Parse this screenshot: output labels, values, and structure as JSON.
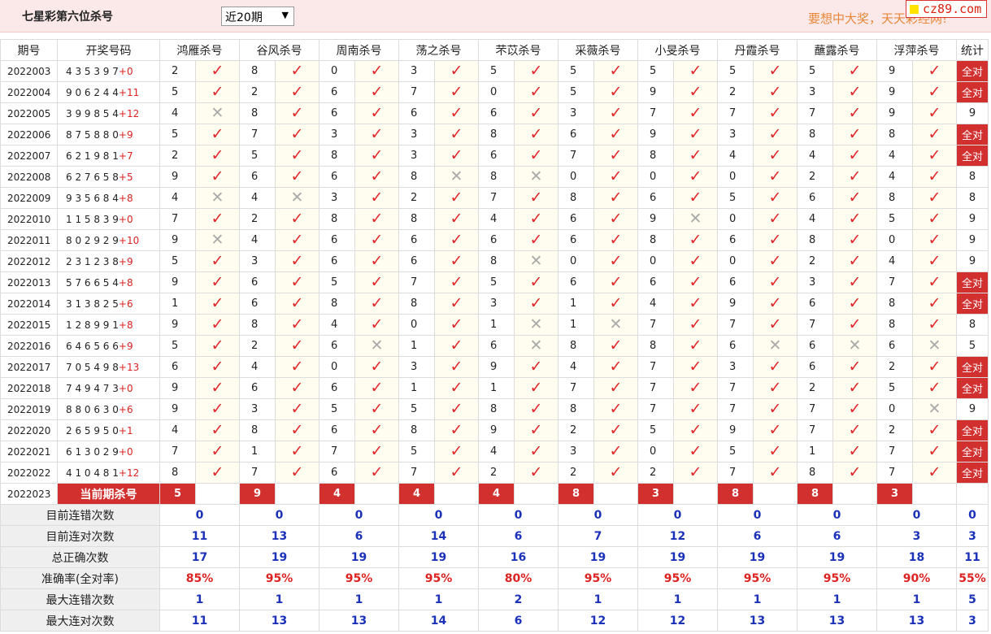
{
  "header": {
    "title": "七星彩第六位杀号",
    "period_select": "近20期",
    "slogan": "要想中大奖，天天彩经网!",
    "logo": "cz89.com"
  },
  "columns": {
    "issue": "期号",
    "draw": "开奖号码",
    "experts": [
      "鸿雁杀号",
      "谷风杀号",
      "周南杀号",
      "荡之杀号",
      "芣苡杀号",
      "采薇杀号",
      "小旻杀号",
      "丹霞杀号",
      "蘸露杀号",
      "浮萍杀号"
    ],
    "stat": "统计"
  },
  "rows": [
    {
      "issue": "2022003",
      "draw": "4 3 5 3 9 7",
      "plus": "+0",
      "kills": [
        2,
        8,
        0,
        3,
        5,
        5,
        5,
        5,
        5,
        9
      ],
      "ok": [
        1,
        1,
        1,
        1,
        1,
        1,
        1,
        1,
        1,
        1
      ],
      "stat": "全对"
    },
    {
      "issue": "2022004",
      "draw": "9 0 6 2 4 4",
      "plus": "+11",
      "kills": [
        5,
        2,
        6,
        7,
        0,
        5,
        9,
        2,
        3,
        9
      ],
      "ok": [
        1,
        1,
        1,
        1,
        1,
        1,
        1,
        1,
        1,
        1
      ],
      "stat": "全对"
    },
    {
      "issue": "2022005",
      "draw": "3 9 9 8 5 4",
      "plus": "+12",
      "kills": [
        4,
        8,
        6,
        6,
        6,
        3,
        7,
        7,
        7,
        9
      ],
      "ok": [
        0,
        1,
        1,
        1,
        1,
        1,
        1,
        1,
        1,
        1
      ],
      "stat": "9"
    },
    {
      "issue": "2022006",
      "draw": "8 7 5 8 8 0",
      "plus": "+9",
      "kills": [
        5,
        7,
        3,
        3,
        8,
        6,
        9,
        3,
        8,
        8
      ],
      "ok": [
        1,
        1,
        1,
        1,
        1,
        1,
        1,
        1,
        1,
        1
      ],
      "stat": "全对"
    },
    {
      "issue": "2022007",
      "draw": "6 2 1 9 8 1",
      "plus": "+7",
      "kills": [
        2,
        5,
        8,
        3,
        6,
        7,
        8,
        4,
        4,
        4
      ],
      "ok": [
        1,
        1,
        1,
        1,
        1,
        1,
        1,
        1,
        1,
        1
      ],
      "stat": "全对"
    },
    {
      "issue": "2022008",
      "draw": "6 2 7 6 5 8",
      "plus": "+5",
      "kills": [
        9,
        6,
        6,
        8,
        8,
        0,
        0,
        0,
        2,
        4
      ],
      "ok": [
        1,
        1,
        1,
        0,
        0,
        1,
        1,
        1,
        1,
        1
      ],
      "stat": "8"
    },
    {
      "issue": "2022009",
      "draw": "9 3 5 6 8 4",
      "plus": "+8",
      "kills": [
        4,
        4,
        3,
        2,
        7,
        8,
        6,
        5,
        6,
        8
      ],
      "ok": [
        0,
        0,
        1,
        1,
        1,
        1,
        1,
        1,
        1,
        1
      ],
      "stat": "8"
    },
    {
      "issue": "2022010",
      "draw": "1 1 5 8 3 9",
      "plus": "+0",
      "kills": [
        7,
        2,
        8,
        8,
        4,
        6,
        9,
        0,
        4,
        5
      ],
      "ok": [
        1,
        1,
        1,
        1,
        1,
        1,
        0,
        1,
        1,
        1
      ],
      "stat": "9"
    },
    {
      "issue": "2022011",
      "draw": "8 0 2 9 2 9",
      "plus": "+10",
      "kills": [
        9,
        4,
        6,
        6,
        6,
        6,
        8,
        6,
        8,
        0
      ],
      "ok": [
        0,
        1,
        1,
        1,
        1,
        1,
        1,
        1,
        1,
        1
      ],
      "stat": "9"
    },
    {
      "issue": "2022012",
      "draw": "2 3 1 2 3 8",
      "plus": "+9",
      "kills": [
        5,
        3,
        6,
        6,
        8,
        0,
        0,
        0,
        2,
        4
      ],
      "ok": [
        1,
        1,
        1,
        1,
        0,
        1,
        1,
        1,
        1,
        1
      ],
      "stat": "9"
    },
    {
      "issue": "2022013",
      "draw": "5 7 6 6 5 4",
      "plus": "+8",
      "kills": [
        9,
        6,
        5,
        7,
        5,
        6,
        6,
        6,
        3,
        7
      ],
      "ok": [
        1,
        1,
        1,
        1,
        1,
        1,
        1,
        1,
        1,
        1
      ],
      "stat": "全对"
    },
    {
      "issue": "2022014",
      "draw": "3 1 3 8 2 5",
      "plus": "+6",
      "kills": [
        1,
        6,
        8,
        8,
        3,
        1,
        4,
        9,
        6,
        8
      ],
      "ok": [
        1,
        1,
        1,
        1,
        1,
        1,
        1,
        1,
        1,
        1
      ],
      "stat": "全对"
    },
    {
      "issue": "2022015",
      "draw": "1 2 8 9 9 1",
      "plus": "+8",
      "kills": [
        9,
        8,
        4,
        0,
        1,
        1,
        7,
        7,
        7,
        8
      ],
      "ok": [
        1,
        1,
        1,
        1,
        0,
        0,
        1,
        1,
        1,
        1
      ],
      "stat": "8"
    },
    {
      "issue": "2022016",
      "draw": "6 4 6 5 6 6",
      "plus": "+9",
      "kills": [
        5,
        2,
        6,
        1,
        6,
        8,
        8,
        6,
        6,
        6
      ],
      "ok": [
        1,
        1,
        0,
        1,
        0,
        1,
        1,
        0,
        0,
        0
      ],
      "stat": "5"
    },
    {
      "issue": "2022017",
      "draw": "7 0 5 4 9 8",
      "plus": "+13",
      "kills": [
        6,
        4,
        0,
        3,
        9,
        4,
        7,
        3,
        6,
        2
      ],
      "ok": [
        1,
        1,
        1,
        1,
        1,
        1,
        1,
        1,
        1,
        1
      ],
      "stat": "全对"
    },
    {
      "issue": "2022018",
      "draw": "7 4 9 4 7 3",
      "plus": "+0",
      "kills": [
        9,
        6,
        6,
        1,
        1,
        7,
        7,
        7,
        2,
        5
      ],
      "ok": [
        1,
        1,
        1,
        1,
        1,
        1,
        1,
        1,
        1,
        1
      ],
      "stat": "全对"
    },
    {
      "issue": "2022019",
      "draw": "8 8 0 6 3 0",
      "plus": "+6",
      "kills": [
        9,
        3,
        5,
        5,
        8,
        8,
        7,
        7,
        7,
        0
      ],
      "ok": [
        1,
        1,
        1,
        1,
        1,
        1,
        1,
        1,
        1,
        0
      ],
      "stat": "9"
    },
    {
      "issue": "2022020",
      "draw": "2 6 5 9 5 0",
      "plus": "+1",
      "kills": [
        4,
        8,
        6,
        8,
        9,
        2,
        5,
        9,
        7,
        2
      ],
      "ok": [
        1,
        1,
        1,
        1,
        1,
        1,
        1,
        1,
        1,
        1
      ],
      "stat": "全对"
    },
    {
      "issue": "2022021",
      "draw": "6 1 3 0 2 9",
      "plus": "+0",
      "kills": [
        7,
        1,
        7,
        5,
        4,
        3,
        0,
        5,
        1,
        7
      ],
      "ok": [
        1,
        1,
        1,
        1,
        1,
        1,
        1,
        1,
        1,
        1
      ],
      "stat": "全对"
    },
    {
      "issue": "2022022",
      "draw": "4 1 0 4 8 1",
      "plus": "+12",
      "kills": [
        8,
        7,
        6,
        7,
        2,
        2,
        2,
        7,
        8,
        7
      ],
      "ok": [
        1,
        1,
        1,
        1,
        1,
        1,
        1,
        1,
        1,
        1
      ],
      "stat": "全对"
    }
  ],
  "current": {
    "issue": "2022023",
    "label": "当前期杀号",
    "kills": [
      "5",
      "9",
      "4",
      "4",
      "4",
      "8",
      "3",
      "8",
      "8",
      "3"
    ]
  },
  "summary": [
    {
      "label": "目前连错次数",
      "values": [
        "0",
        "0",
        "0",
        "0",
        "0",
        "0",
        "0",
        "0",
        "0",
        "0"
      ],
      "stat": "0",
      "type": "val"
    },
    {
      "label": "目前连对次数",
      "values": [
        "11",
        "13",
        "6",
        "14",
        "6",
        "7",
        "12",
        "6",
        "6",
        "3"
      ],
      "stat": "3",
      "type": "val"
    },
    {
      "label": "总正确次数",
      "values": [
        "17",
        "19",
        "19",
        "19",
        "16",
        "19",
        "19",
        "19",
        "19",
        "18"
      ],
      "stat": "11",
      "type": "val"
    },
    {
      "label": "准确率(全对率)",
      "values": [
        "85%",
        "95%",
        "95%",
        "95%",
        "80%",
        "95%",
        "95%",
        "95%",
        "95%",
        "90%"
      ],
      "stat": "55%",
      "type": "pct"
    },
    {
      "label": "最大连错次数",
      "values": [
        "1",
        "1",
        "1",
        "1",
        "2",
        "1",
        "1",
        "1",
        "1",
        "1"
      ],
      "stat": "5",
      "type": "val"
    },
    {
      "label": "最大连对次数",
      "values": [
        "11",
        "13",
        "13",
        "14",
        "6",
        "12",
        "12",
        "13",
        "13",
        "13"
      ],
      "stat": "3",
      "type": "val"
    }
  ],
  "icons": {
    "correct": "check-icon",
    "wrong": "cross-icon"
  },
  "colors": {
    "accent": "#d22f2f",
    "summary_blue": "#1b32b8",
    "header_bg": "#fbe8e8"
  }
}
